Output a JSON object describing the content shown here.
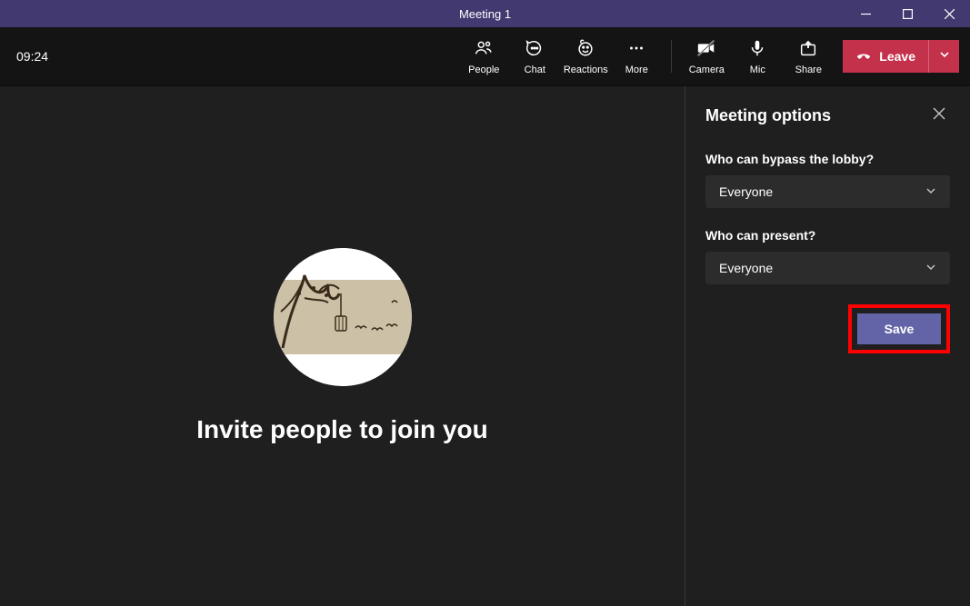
{
  "titlebar": {
    "title": "Meeting 1"
  },
  "toolbar": {
    "time": "09:24",
    "people": "People",
    "chat": "Chat",
    "reactions": "Reactions",
    "more": "More",
    "camera": "Camera",
    "mic": "Mic",
    "share": "Share",
    "leave": "Leave"
  },
  "main": {
    "invite": "Invite people to join you"
  },
  "panel": {
    "title": "Meeting options",
    "bypass_label": "Who can bypass the lobby?",
    "bypass_value": "Everyone",
    "present_label": "Who can present?",
    "present_value": "Everyone",
    "save": "Save"
  }
}
